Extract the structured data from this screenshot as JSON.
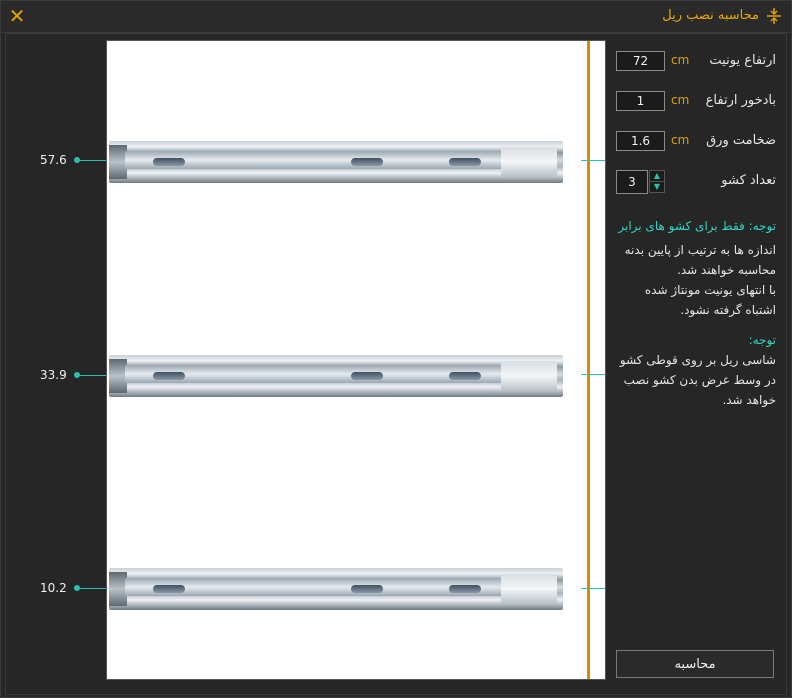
{
  "window": {
    "title": "محاسبه نصب ریل"
  },
  "fields": {
    "unit_height": {
      "label": "ارتفاع یونیت",
      "value": "72",
      "unit": "cm"
    },
    "height_offset": {
      "label": "بادخور ارتفاع",
      "value": "1",
      "unit": "cm"
    },
    "sheet_thickness": {
      "label": "ضخامت ورق",
      "value": "1.6",
      "unit": "cm"
    },
    "drawer_count": {
      "label": "تعداد کشو",
      "value": "3"
    }
  },
  "notes": {
    "note1_title": "توجه: فقط برای کشو های برابر",
    "note1_line1": "اندازه ها به ترتیب از پایین بدنه",
    "note1_line2": "محاسبه خواهند شد.",
    "note1_line3": "با انتهای یونیت مونتاژ شده",
    "note1_line4": "اشتباه گرفته نشود.",
    "note2_title": "توجه:",
    "note2_line1": "شاسی ریل بر روی قوطی کشو",
    "note2_line2": "در وسط عرض بدن کشو نصب",
    "note2_line3": "خواهد شد."
  },
  "measurements": [
    "57.6",
    "33.9",
    "10.2"
  ],
  "buttons": {
    "calculate": "محاسبه"
  },
  "colors": {
    "accent": "#e0a300",
    "teal": "#2bbfae",
    "background": "#262626"
  }
}
